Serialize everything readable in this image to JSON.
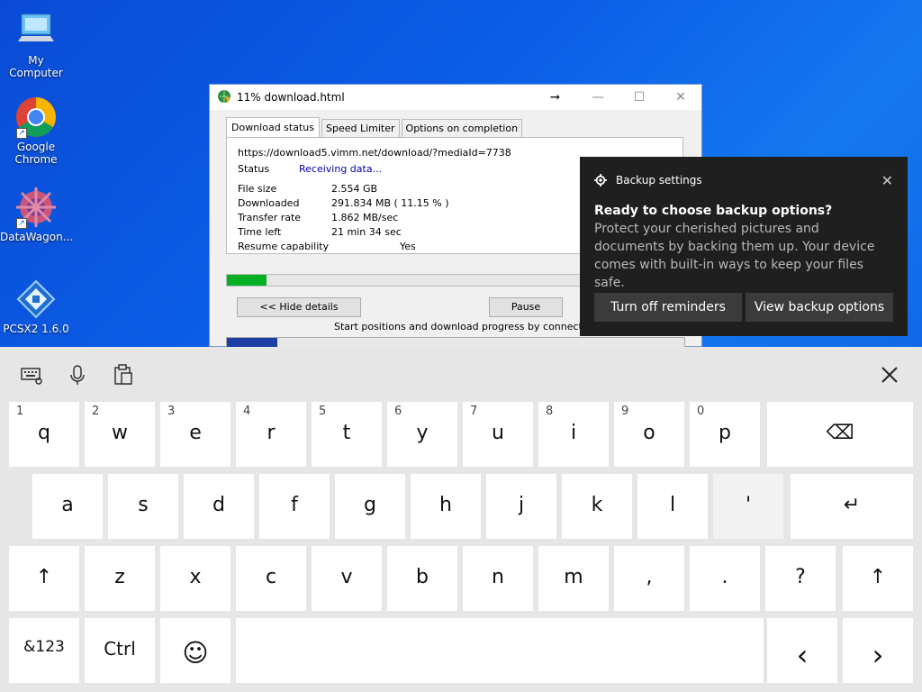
{
  "desktop": {
    "icons": [
      {
        "label": "My Computer"
      },
      {
        "label": "Google Chrome"
      },
      {
        "label": "DataWagon..."
      },
      {
        "label": "PCSX2 1.6.0"
      }
    ]
  },
  "idm": {
    "title": "11% download.html",
    "tabs": [
      "Download status",
      "Speed Limiter",
      "Options on completion"
    ],
    "url": "https://download5.vimm.net/download/?mediaId=7738",
    "rows": [
      {
        "label": "Status",
        "value": "Receiving data..."
      },
      {
        "label": "File size",
        "value": "2.554  GB"
      },
      {
        "label": "Downloaded",
        "value": "291.834  MB  ( 11.15 % )"
      },
      {
        "label": "Transfer rate",
        "value": "1.862  MB/sec"
      },
      {
        "label": "Time left",
        "value": "21 min 34 sec"
      },
      {
        "label": "Resume capability",
        "value": "Yes"
      }
    ],
    "progress": 0.1115,
    "hide_details": "<< Hide details",
    "pause": "Pause",
    "connections_text": "Start positions and download progress by connections"
  },
  "toast": {
    "app": "Backup settings",
    "title": "Ready to choose backup options?",
    "body": "Protect your cherished pictures and documents by backing them up. Your device comes with built-in ways to keep your files safe.",
    "btn_off": "Turn off reminders",
    "btn_view": "View backup options"
  },
  "keyboard": {
    "row1": [
      {
        "main": "q",
        "sub": "1"
      },
      {
        "main": "w",
        "sub": "2"
      },
      {
        "main": "e",
        "sub": "3"
      },
      {
        "main": "r",
        "sub": "4"
      },
      {
        "main": "t",
        "sub": "5"
      },
      {
        "main": "y",
        "sub": "6"
      },
      {
        "main": "u",
        "sub": "7"
      },
      {
        "main": "i",
        "sub": "8"
      },
      {
        "main": "o",
        "sub": "9"
      },
      {
        "main": "p",
        "sub": "0"
      }
    ],
    "row2": [
      "a",
      "s",
      "d",
      "f",
      "g",
      "h",
      "j",
      "k",
      "l",
      "'"
    ],
    "row3": [
      "z",
      "x",
      "c",
      "v",
      "b",
      "n",
      "m",
      ",",
      ".",
      "?"
    ],
    "symbols_label": "&123",
    "ctrl_label": "Ctrl"
  }
}
